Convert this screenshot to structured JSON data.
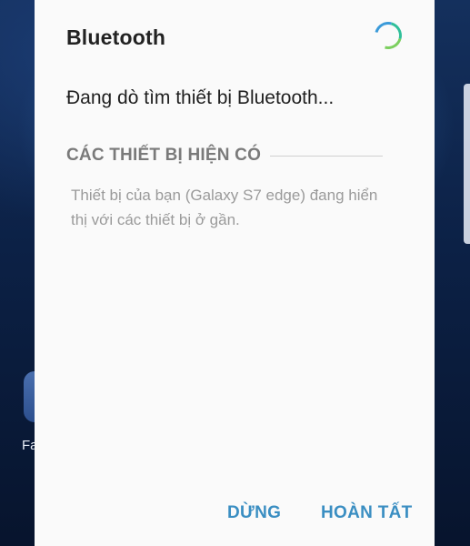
{
  "dialog": {
    "title": "Bluetooth",
    "status": "Đang dò tìm thiết bị Bluetooth...",
    "section_title": "CÁC THIẾT BỊ HIỆN CÓ",
    "description": "Thiết bị của bạn (Galaxy S7 edge) đang hiển thị với các thiết bị ở gần.",
    "buttons": {
      "stop": "DỪNG",
      "done": "HOÀN TẤT"
    }
  },
  "background": {
    "partial_app_label": "Fa"
  },
  "colors": {
    "accent": "#3a8ec2",
    "dialog_bg": "#fafafa",
    "spinner": [
      "#3a9ad9",
      "#2fbf9a",
      "#7ccf5f"
    ]
  }
}
